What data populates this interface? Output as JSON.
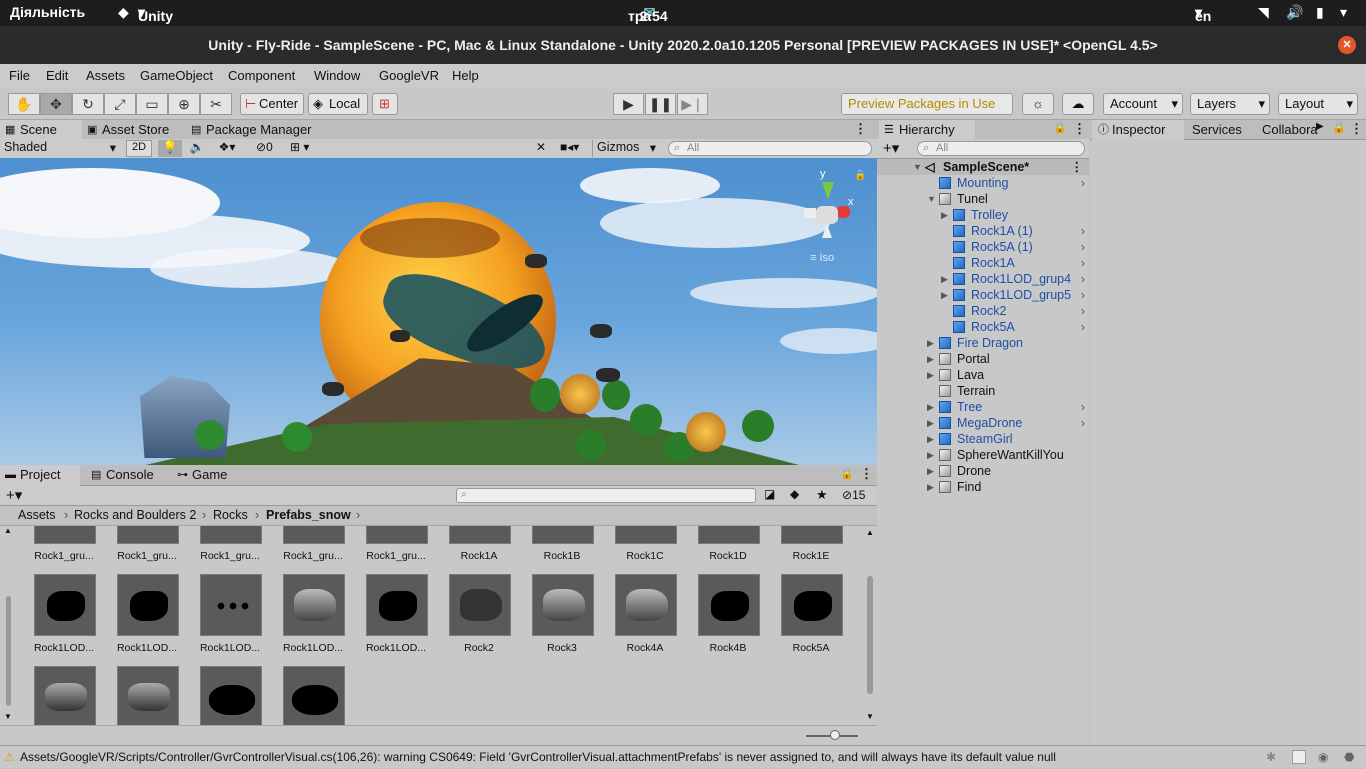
{
  "system": {
    "activities": "Діяльність",
    "app": "Unity",
    "date": "тра 10",
    "time": "2:54 PM",
    "lang": "en"
  },
  "window": {
    "title": "Unity - Fly-Ride - SampleScene - PC, Mac & Linux Standalone - Unity 2020.2.0a10.1205 Personal [PREVIEW PACKAGES IN USE]* <OpenGL 4.5>"
  },
  "menu": [
    "File",
    "Edit",
    "Assets",
    "GameObject",
    "Component",
    "Window",
    "GoogleVR",
    "Help"
  ],
  "toolbar": {
    "pivot": "Center",
    "space": "Local",
    "preview": "Preview Packages in Use",
    "account": "Account",
    "layers": "Layers",
    "layout": "Layout"
  },
  "scene_tabs": [
    "Scene",
    "Asset Store",
    "Package Manager"
  ],
  "scene_bar": {
    "shading": "Shaded",
    "mode2d": "2D",
    "hidden_count": "0",
    "gizmos": "Gizmos",
    "search_placeholder": "All"
  },
  "gizmo": {
    "y": "y",
    "x": "x",
    "iso": "Iso"
  },
  "hierarchy": {
    "tab": "Hierarchy",
    "search_placeholder": "All",
    "scene": "SampleScene*",
    "items": [
      {
        "label": "Mounting",
        "blue": true,
        "arrow": "",
        "chev": true,
        "indent": 0
      },
      {
        "label": "Tunel",
        "blue": false,
        "arrow": "▼",
        "chev": false,
        "indent": 0
      },
      {
        "label": "Trolley",
        "blue": true,
        "arrow": "▶",
        "chev": false,
        "indent": 1
      },
      {
        "label": "Rock1A (1)",
        "blue": true,
        "arrow": "",
        "chev": true,
        "indent": 1
      },
      {
        "label": "Rock5A (1)",
        "blue": true,
        "arrow": "",
        "chev": true,
        "indent": 1
      },
      {
        "label": "Rock1A",
        "blue": true,
        "arrow": "",
        "chev": true,
        "indent": 1
      },
      {
        "label": "Rock1LOD_grup4",
        "blue": true,
        "arrow": "▶",
        "chev": true,
        "indent": 1
      },
      {
        "label": "Rock1LOD_grup5",
        "blue": true,
        "arrow": "▶",
        "chev": true,
        "indent": 1
      },
      {
        "label": "Rock2",
        "blue": true,
        "arrow": "",
        "chev": true,
        "indent": 1
      },
      {
        "label": "Rock5A",
        "blue": true,
        "arrow": "",
        "chev": true,
        "indent": 1
      },
      {
        "label": "Fire Dragon",
        "blue": true,
        "arrow": "▶",
        "chev": false,
        "indent": 0
      },
      {
        "label": "Portal",
        "blue": false,
        "arrow": "▶",
        "chev": false,
        "indent": 0
      },
      {
        "label": "Lava",
        "blue": false,
        "arrow": "▶",
        "chev": false,
        "indent": 0
      },
      {
        "label": "Terrain",
        "blue": false,
        "arrow": "",
        "chev": false,
        "indent": 0
      },
      {
        "label": "Tree",
        "blue": true,
        "arrow": "▶",
        "chev": true,
        "indent": 0
      },
      {
        "label": "MegaDrone",
        "blue": true,
        "arrow": "▶",
        "chev": true,
        "indent": 0
      },
      {
        "label": "SteamGirl",
        "blue": true,
        "arrow": "▶",
        "chev": false,
        "indent": 0
      },
      {
        "label": "SphereWantKillYou",
        "blue": false,
        "arrow": "▶",
        "chev": false,
        "indent": 0
      },
      {
        "label": "Drone",
        "blue": false,
        "arrow": "▶",
        "chev": false,
        "indent": 0
      },
      {
        "label": "Find",
        "blue": false,
        "arrow": "▶",
        "chev": false,
        "indent": 0
      }
    ]
  },
  "inspector_tabs": [
    "Inspector",
    "Services",
    "Collabora"
  ],
  "project": {
    "tabs": [
      "Project",
      "Console",
      "Game"
    ],
    "hidden_count": "15",
    "breadcrumb": [
      "Assets",
      "Rocks and Boulders 2",
      "Rocks",
      "Prefabs_snow"
    ],
    "row1": [
      "Rock1_gru...",
      "Rock1_gru...",
      "Rock1_gru...",
      "Rock1_gru...",
      "Rock1_gru...",
      "Rock1A",
      "Rock1B",
      "Rock1C",
      "Rock1D",
      "Rock1E"
    ],
    "row2": [
      "Rock1LOD...",
      "Rock1LOD...",
      "Rock1LOD...",
      "Rock1LOD...",
      "Rock1LOD...",
      "Rock2",
      "Rock3",
      "Rock4A",
      "Rock4B",
      "Rock5A"
    ]
  },
  "status": {
    "message": "Assets/GoogleVR/Scripts/Controller/GvrControllerVisual.cs(106,26): warning CS0649: Field 'GvrControllerVisual.attachmentPrefabs' is never assigned to, and will always have its default value null"
  },
  "colors": {
    "accent_blue": "#1e4fa8",
    "sun": "#f5a020",
    "warn": "#e0a000",
    "close": "#e0572a"
  }
}
